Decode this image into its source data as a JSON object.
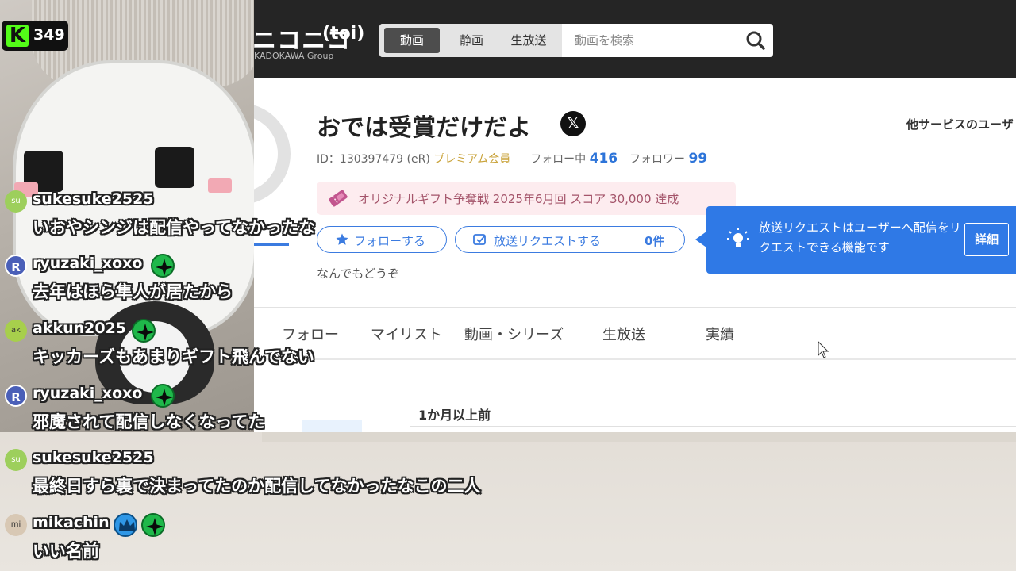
{
  "viewer_counter": {
    "count": "349",
    "logo": "K"
  },
  "site": {
    "logo_text": "ニコニコ",
    "logo_toi": "(toi)",
    "logo_sub": "KADOKAWA Group",
    "search_tabs": [
      "動画",
      "静画",
      "生放送"
    ],
    "search_placeholder": "動画を検索"
  },
  "profile": {
    "name": "おでは受賞だけだよ",
    "id_text": "ID：130397479 (eR)",
    "premium": "プレミアム会員",
    "following_label": "フォロー中",
    "following_count": "416",
    "followers_label": "フォロワー",
    "followers_count": "99",
    "gift_banner": "オリジナルギフト争奪戦 2025年6月回 スコア 30,000 達成",
    "follow_button": "フォローする",
    "request_button": "放送リクエストする",
    "request_count": "0件",
    "description": "なんでもどうぞ",
    "other_services": "他サービスのユーザ"
  },
  "tooltip": {
    "text": "放送リクエストはユーザーへ配信をリクエストできる機能です",
    "button": "詳細"
  },
  "tabs": [
    "フォロー",
    "マイリスト",
    "動画・シリーズ",
    "生放送",
    "実績"
  ],
  "section_title": "1か月以上前",
  "chat": [
    {
      "user": "sukesuke2525",
      "avatar": "su",
      "message": "いおやシンジは配信やってなかったな"
    },
    {
      "user": "ryuzaki_xoxo",
      "avatar": "R",
      "message": "去年はほら隼人が居たから"
    },
    {
      "user": "akkun2025",
      "avatar": "ak",
      "message": "キッカーズもあまりギフト飛んでない"
    },
    {
      "user": "ryuzaki_xoxo",
      "avatar": "R",
      "message": "邪魔されて配信しなくなってた"
    },
    {
      "user": "sukesuke2525",
      "avatar": "su",
      "message": "最終日すら裏で決まってたのか配信してなかったなこの二人"
    },
    {
      "user": "mikachin",
      "avatar": "mi",
      "message": "いい名前"
    }
  ],
  "colors": {
    "kick_green": "#53fc18",
    "nico_blue": "#2f79e6",
    "premium_gold": "#c9a33b"
  }
}
